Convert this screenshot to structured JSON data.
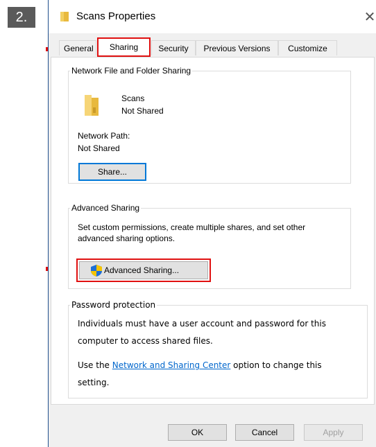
{
  "step_label": "2.",
  "window": {
    "title": "Scans Properties",
    "close_glyph": "✕"
  },
  "tabs": [
    {
      "label": "General"
    },
    {
      "label": "Sharing",
      "active": true
    },
    {
      "label": "Security"
    },
    {
      "label": "Previous Versions"
    },
    {
      "label": "Customize"
    }
  ],
  "network_sharing": {
    "legend": "Network File and Folder Sharing",
    "folder_name": "Scans",
    "folder_status": "Not Shared",
    "path_label": "Network Path:",
    "path_value": "Not Shared",
    "share_button": "Share..."
  },
  "advanced_sharing": {
    "legend": "Advanced Sharing",
    "description_line1": "Set custom permissions, create multiple shares, and set other",
    "description_line2": "advanced sharing options.",
    "button": "Advanced Sharing..."
  },
  "password_protection": {
    "legend": "Password protection",
    "line1": "Individuals must have a user account and password for this",
    "line2": "computer to access shared files.",
    "use_prefix": "Use the ",
    "link_text": "Network and Sharing Center",
    "use_suffix": " option to change this",
    "line4": "setting."
  },
  "footer": {
    "ok": "OK",
    "cancel": "Cancel",
    "apply": "Apply"
  },
  "colors": {
    "highlight": "#e01010",
    "focus": "#0078d7",
    "link": "#0066cc"
  },
  "icons": [
    "folder-icon",
    "shield-icon",
    "arrow-right-icon",
    "close-icon"
  ]
}
